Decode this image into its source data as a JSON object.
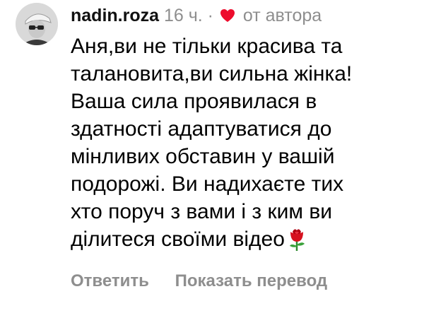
{
  "comment": {
    "username": "nadin.roza",
    "time": "16 ч.",
    "separator": "·",
    "author_badge_icon": "heart-icon",
    "author_badge_color": "#ed0c2d",
    "author_badge_label": "от автора",
    "body_lines": [
      "Аня,ви не тільки красива та",
      "талановита,ви сильна жінка!",
      "Ваша сила проявилася в",
      "здатності адаптуватися до",
      "мінливих обставин у вашій",
      "подорожі. Ви надихаєте тих",
      "хто поруч з вами і з ким ви",
      "ділитеся своїми відео"
    ],
    "trailing_emoji": "rose-emoji"
  },
  "actions": {
    "reply_label": "Ответить",
    "translate_label": "Показать перевод"
  }
}
